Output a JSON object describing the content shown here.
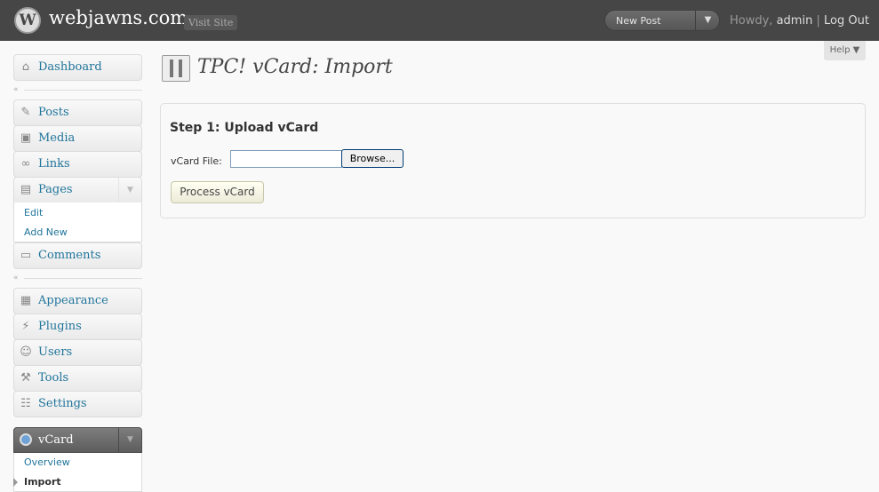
{
  "header": {
    "site_title": "webjawns.com",
    "visit_site": "Visit Site",
    "new_post": "New Post",
    "dropdown_arrow": "▼",
    "greeting": "Howdy,",
    "username": "admin",
    "separator": "|",
    "logout": "Log Out"
  },
  "help": {
    "label": "Help",
    "arrow": "▼"
  },
  "sidebar": {
    "dashboard": "Dashboard",
    "posts": "Posts",
    "media": "Media",
    "links": "Links",
    "pages": "Pages",
    "pages_sub": [
      "Edit",
      "Add New"
    ],
    "comments": "Comments",
    "appearance": "Appearance",
    "plugins": "Plugins",
    "users": "Users",
    "tools": "Tools",
    "settings": "Settings",
    "vcard": "vCard",
    "vcard_sub": [
      "Overview",
      "Import"
    ],
    "collapse_glyph": "«",
    "toggle_glyph": "▼"
  },
  "main": {
    "page_title": "TPC! vCard: Import",
    "step_title": "Step 1: Upload vCard",
    "file_label": "vCard File:",
    "file_value": "",
    "browse_label": "Browse...",
    "process_label": "Process vCard"
  },
  "icons": {
    "dashboard": "house-icon",
    "posts": "pushpin-icon",
    "media": "camera-icon",
    "links": "chain-icon",
    "pages": "pages-icon",
    "comments": "comment-bubble-icon",
    "appearance": "window-icon",
    "plugins": "plug-icon",
    "users": "users-icon",
    "tools": "tools-icon",
    "settings": "sliders-icon",
    "vcard": "gear-icon"
  },
  "colors": {
    "link": "#21759b",
    "header_bg": "#464646",
    "vcard_head": "#6d6d6d"
  }
}
